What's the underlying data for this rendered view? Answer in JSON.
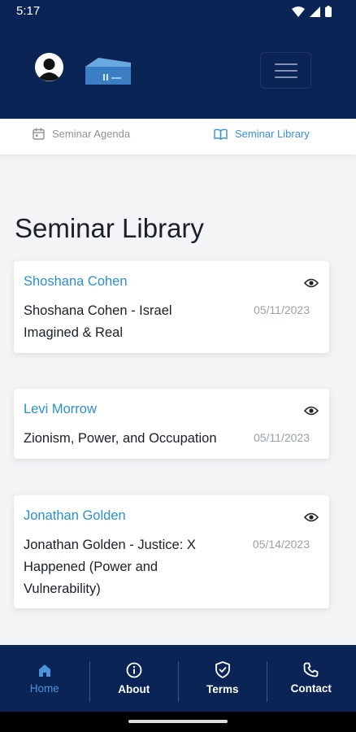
{
  "status": {
    "time": "5:17"
  },
  "header": {
    "logo_name": "logo-icon",
    "avatar_name": "avatar"
  },
  "tabs": [
    {
      "label": "Seminar Agenda",
      "icon": "calendar-icon",
      "active": false
    },
    {
      "label": "Seminar Library",
      "icon": "book-icon",
      "active": true
    }
  ],
  "page_title": "Seminar Library",
  "cards": [
    {
      "author": "Shoshana Cohen",
      "title_line1": "Shoshana Cohen - Israel",
      "title_line2": "Imagined & Real",
      "title_line3": "",
      "date": "05/11/2023"
    },
    {
      "author": "Levi Morrow",
      "title_line1": "Zionism, Power, and Occupation",
      "title_line2": "",
      "title_line3": "",
      "date": "05/11/2023"
    },
    {
      "author": "Jonathan Golden",
      "title_line1": "Jonathan Golden - Justice: X",
      "title_line2": "Happened (Power and",
      "title_line3": "Vulnerability)",
      "date": "05/14/2023"
    }
  ],
  "bottom_nav": [
    {
      "label": "Home",
      "icon": "home-icon",
      "active": true
    },
    {
      "label": "About",
      "icon": "info-icon",
      "active": false
    },
    {
      "label": "Terms",
      "icon": "shield-check-icon",
      "active": false
    },
    {
      "label": "Contact",
      "icon": "phone-icon",
      "active": false
    }
  ],
  "colors": {
    "navy": "#0b2456",
    "accent": "#3a8fd4",
    "author": "#2b8fc9",
    "background": "#f3f4f6"
  }
}
